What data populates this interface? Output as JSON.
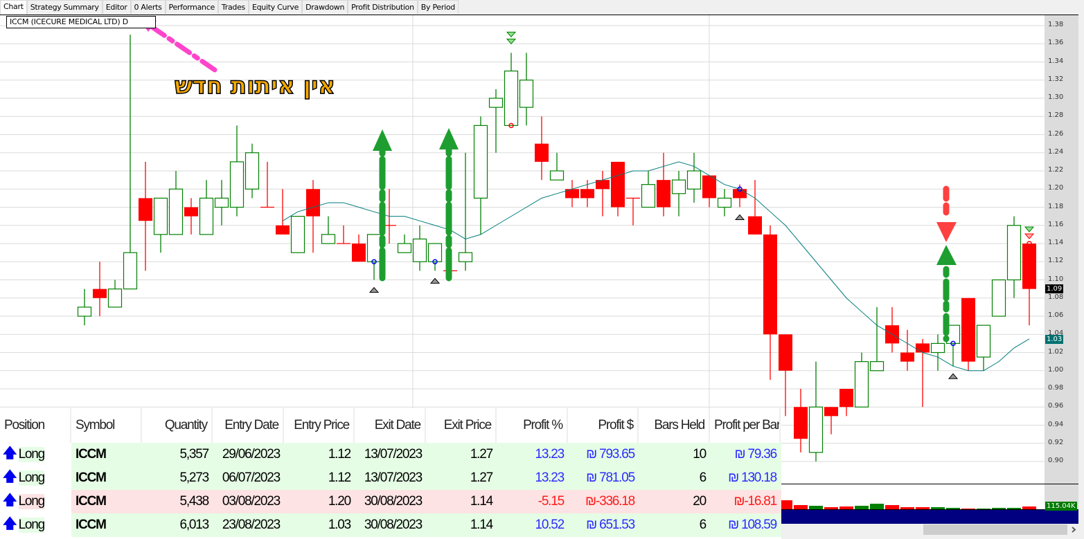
{
  "tabs": [
    "Chart",
    "Strategy Summary",
    "Editor",
    "0 Alerts",
    "Performance",
    "Trades",
    "Equity Curve",
    "Drawdown",
    "Profit Distribution",
    "By Period"
  ],
  "chart_title": "ICCM (ICECURE MEDICAL LTD) D",
  "annotation_text": "אין איתות חדש",
  "price_axis_labels": [
    "1.38",
    "1.36",
    "1.34",
    "1.32",
    "1.30",
    "1.28",
    "1.26",
    "1.24",
    "1.22",
    "1.20",
    "1.18",
    "1.16",
    "1.14",
    "1.12",
    "1.10",
    "1.08",
    "1.06",
    "1.04",
    "1.02",
    "1.00",
    "0.98",
    "0.96",
    "0.94",
    "0.92",
    "0.90"
  ],
  "last_price_tag": "1.09",
  "ma_price_tag": "1.03",
  "volume_tag": "115.04K",
  "colors": {
    "up": "#008000",
    "down": "#ff0000",
    "ma": "#007b7b",
    "volume_bg": "#000080",
    "win_row": "#e5fde5",
    "loss_row": "#fde3e3",
    "annotation_pink": "#ff44cc",
    "signal_green": "#1e9e30",
    "signal_red": "#ff4040"
  },
  "chart_data": {
    "type": "candlestick",
    "symbol": "ICCM",
    "ylim": [
      0.88,
      1.39
    ],
    "ohlc": [
      [
        1.06,
        1.09,
        1.05,
        1.07
      ],
      [
        1.09,
        1.12,
        1.06,
        1.08
      ],
      [
        1.07,
        1.1,
        1.07,
        1.09
      ],
      [
        1.09,
        1.37,
        1.09,
        1.13
      ],
      [
        1.19,
        1.23,
        1.11,
        1.165
      ],
      [
        1.15,
        1.19,
        1.13,
        1.19
      ],
      [
        1.15,
        1.22,
        1.15,
        1.2
      ],
      [
        1.18,
        1.19,
        1.15,
        1.17
      ],
      [
        1.15,
        1.21,
        1.15,
        1.19
      ],
      [
        1.18,
        1.21,
        1.16,
        1.19
      ],
      [
        1.18,
        1.27,
        1.17,
        1.23
      ],
      [
        1.2,
        1.25,
        1.19,
        1.24
      ],
      [
        1.18,
        1.23,
        1.18,
        1.18
      ],
      [
        1.16,
        1.2,
        1.15,
        1.15
      ],
      [
        1.13,
        1.17,
        1.13,
        1.17
      ],
      [
        1.2,
        1.21,
        1.13,
        1.17
      ],
      [
        1.14,
        1.17,
        1.14,
        1.15
      ],
      [
        1.14,
        1.16,
        1.14,
        1.14
      ],
      [
        1.14,
        1.15,
        1.12,
        1.12
      ],
      [
        1.12,
        1.15,
        1.1,
        1.15
      ],
      [
        1.16,
        1.2,
        1.14,
        1.16
      ],
      [
        1.13,
        1.15,
        1.13,
        1.14
      ],
      [
        1.12,
        1.16,
        1.11,
        1.145
      ],
      [
        1.12,
        1.14,
        1.11,
        1.14
      ],
      [
        1.11,
        1.14,
        1.11,
        1.11
      ],
      [
        1.12,
        1.24,
        1.11,
        1.13
      ],
      [
        1.19,
        1.28,
        1.15,
        1.27
      ],
      [
        1.29,
        1.31,
        1.24,
        1.3
      ],
      [
        1.27,
        1.35,
        1.27,
        1.33
      ],
      [
        1.29,
        1.35,
        1.27,
        1.32
      ],
      [
        1.25,
        1.28,
        1.21,
        1.23
      ],
      [
        1.21,
        1.24,
        1.21,
        1.22
      ],
      [
        1.2,
        1.21,
        1.18,
        1.19
      ],
      [
        1.2,
        1.21,
        1.18,
        1.19
      ],
      [
        1.21,
        1.22,
        1.17,
        1.2
      ],
      [
        1.23,
        1.23,
        1.17,
        1.18
      ],
      [
        1.19,
        1.19,
        1.16,
        1.19
      ],
      [
        1.18,
        1.22,
        1.18,
        1.205
      ],
      [
        1.21,
        1.24,
        1.17,
        1.18
      ],
      [
        1.195,
        1.22,
        1.17,
        1.21
      ],
      [
        1.2,
        1.24,
        1.185,
        1.22
      ],
      [
        1.215,
        1.215,
        1.18,
        1.19
      ],
      [
        1.18,
        1.2,
        1.17,
        1.19
      ],
      [
        1.2,
        1.205,
        1.18,
        1.19
      ],
      [
        1.17,
        1.21,
        1.15,
        1.15
      ],
      [
        1.15,
        1.16,
        0.99,
        1.04
      ],
      [
        1.04,
        1.04,
        0.95,
        1.0
      ],
      [
        0.96,
        0.98,
        0.91,
        0.925
      ],
      [
        0.91,
        1.01,
        0.9,
        0.96
      ],
      [
        0.96,
        0.96,
        0.93,
        0.95
      ],
      [
        0.98,
        0.98,
        0.95,
        0.96
      ],
      [
        0.96,
        1.02,
        0.96,
        1.01
      ],
      [
        1.0,
        1.07,
        1.0,
        1.01
      ],
      [
        1.05,
        1.07,
        1.02,
        1.03
      ],
      [
        1.02,
        1.045,
        1.0,
        1.01
      ],
      [
        1.03,
        1.035,
        0.96,
        1.02
      ],
      [
        1.02,
        1.04,
        1.0,
        1.03
      ],
      [
        1.03,
        1.05,
        1.005,
        1.05
      ],
      [
        1.08,
        1.08,
        1.0,
        1.01
      ],
      [
        1.015,
        1.05,
        1.0,
        1.05
      ],
      [
        1.06,
        1.1,
        1.06,
        1.1
      ],
      [
        1.1,
        1.17,
        1.08,
        1.16
      ],
      [
        1.14,
        1.14,
        1.05,
        1.09
      ]
    ],
    "doji_down": [
      12,
      17,
      20,
      24,
      36
    ],
    "moving_average": {
      "start_index": 13,
      "values": [
        1.165,
        1.175,
        1.18,
        1.185,
        1.185,
        1.18,
        1.175,
        1.17,
        1.17,
        1.165,
        1.16,
        1.155,
        1.145,
        1.15,
        1.16,
        1.17,
        1.18,
        1.19,
        1.195,
        1.2,
        1.205,
        1.21,
        1.215,
        1.22,
        1.22,
        1.225,
        1.23,
        1.225,
        1.215,
        1.205,
        1.2,
        1.19,
        1.175,
        1.16,
        1.14,
        1.12,
        1.1,
        1.08,
        1.065,
        1.05,
        1.04,
        1.03,
        1.02,
        1.015,
        1.005,
        1.0,
        1.0,
        1.01,
        1.025,
        1.035
      ]
    },
    "volume_k": {
      "start_index": 46,
      "values": [
        374,
        173,
        144,
        86,
        115,
        144,
        230,
        173,
        86,
        86,
        86,
        58,
        29,
        29,
        58,
        58,
        115.04
      ],
      "up": [
        false,
        false,
        true,
        false,
        false,
        true,
        true,
        false,
        false,
        false,
        true,
        true,
        false,
        true,
        true,
        true,
        false
      ]
    },
    "entries": [
      {
        "index": 19,
        "price": 1.12
      },
      {
        "index": 23,
        "price": 1.12
      },
      {
        "index": 43,
        "price": 1.2
      },
      {
        "index": 57,
        "price": 1.03
      }
    ],
    "exits": [
      {
        "index": 28,
        "price": 1.27
      },
      {
        "index": 62,
        "price": 1.14
      }
    ]
  },
  "trades": {
    "headers": [
      "Position",
      "Symbol",
      "Quantity",
      "Entry Date",
      "Entry Price",
      "Exit Date",
      "Exit Price",
      "Profit %",
      "Profit $",
      "Bars Held",
      "Profit per Bar"
    ],
    "rows": [
      {
        "position": "Long",
        "symbol": "ICCM",
        "quantity": "5,357",
        "entry_date": "29/06/2023",
        "entry_price": "1.12",
        "exit_date": "13/07/2023",
        "exit_price": "1.27",
        "profit_pct": "13.23",
        "profit": "₪ 793.65",
        "bars": "10",
        "per_bar": "₪ 79.36",
        "win": true
      },
      {
        "position": "Long",
        "symbol": "ICCM",
        "quantity": "5,273",
        "entry_date": "06/07/2023",
        "entry_price": "1.12",
        "exit_date": "13/07/2023",
        "exit_price": "1.27",
        "profit_pct": "13.23",
        "profit": "₪ 781.05",
        "bars": "6",
        "per_bar": "₪ 130.18",
        "win": true
      },
      {
        "position": "Long",
        "symbol": "ICCM",
        "quantity": "5,438",
        "entry_date": "03/08/2023",
        "entry_price": "1.20",
        "exit_date": "30/08/2023",
        "exit_price": "1.14",
        "profit_pct": "-5.15",
        "profit": "₪-336.18",
        "bars": "20",
        "per_bar": "₪-16.81",
        "win": false
      },
      {
        "position": "Long",
        "symbol": "ICCM",
        "quantity": "6,013",
        "entry_date": "23/08/2023",
        "entry_price": "1.03",
        "exit_date": "30/08/2023",
        "exit_price": "1.14",
        "profit_pct": "10.52",
        "profit": "₪ 651.53",
        "bars": "6",
        "per_bar": "₪ 108.59",
        "win": true
      }
    ]
  }
}
